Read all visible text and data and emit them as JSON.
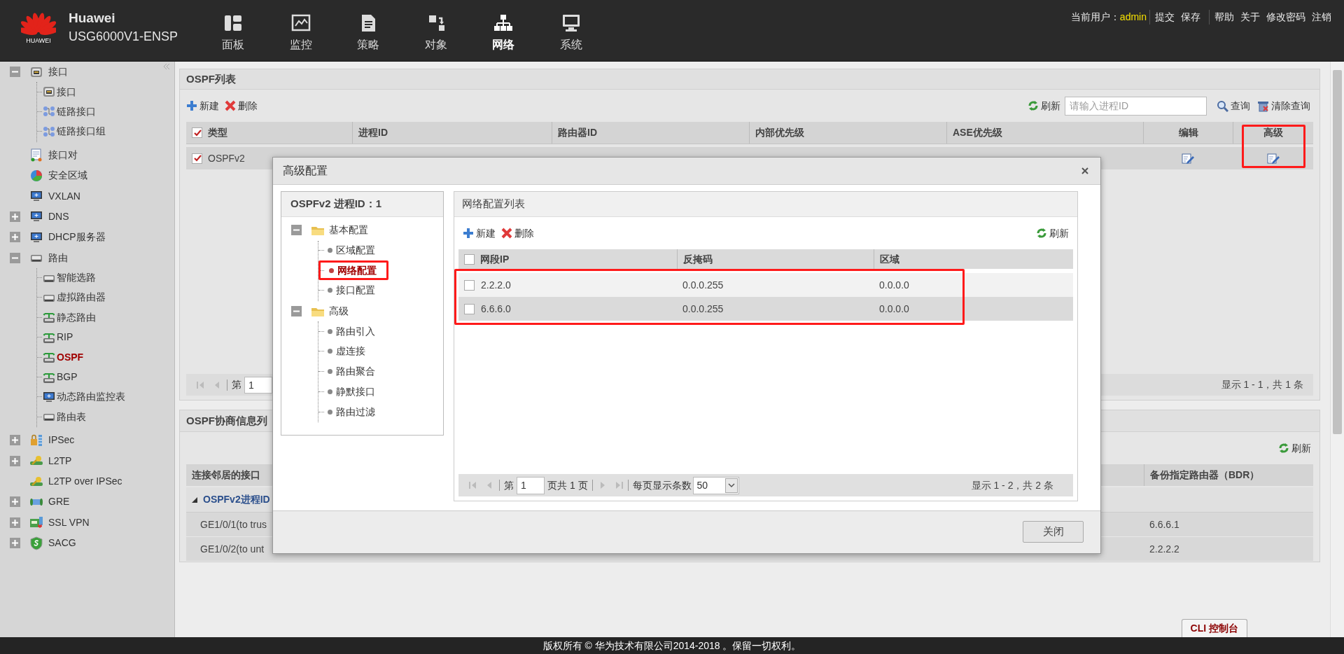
{
  "header": {
    "logo_text": "HUAWEI",
    "brand": "Huawei",
    "model": "USG6000V1-ENSP",
    "nav": [
      {
        "label": "面板",
        "kind": "dashboard",
        "selected": false
      },
      {
        "label": "监控",
        "kind": "monitor",
        "selected": false
      },
      {
        "label": "策略",
        "kind": "policy",
        "selected": false
      },
      {
        "label": "对象",
        "kind": "object",
        "selected": false
      },
      {
        "label": "网络",
        "kind": "network",
        "selected": true
      },
      {
        "label": "系统",
        "kind": "system",
        "selected": false
      }
    ],
    "user_label": "当前用户：",
    "user": "admin",
    "link_groups": [
      [
        "提交",
        "保存"
      ],
      [
        "帮助",
        "关于",
        "修改密码",
        "注销"
      ]
    ]
  },
  "sidebar": {
    "items": [
      {
        "label": "接口",
        "kind": "port",
        "expanded": true,
        "selected": false,
        "children": [
          {
            "label": "接口",
            "kind": "port",
            "selected": false
          },
          {
            "label": "链路接口",
            "kind": "link",
            "selected": false
          },
          {
            "label": "链路接口组",
            "kind": "link",
            "selected": false
          }
        ]
      },
      {
        "label": "接口对",
        "kind": "pair",
        "selected": false
      },
      {
        "label": "安全区域",
        "kind": "zone",
        "selected": false
      },
      {
        "label": "VXLAN",
        "kind": "screen",
        "selected": false
      },
      {
        "label": "DNS",
        "kind": "screen",
        "expanded": false,
        "selected": false
      },
      {
        "label": "DHCP服务器",
        "kind": "screen",
        "expanded": false,
        "selected": false
      },
      {
        "label": "路由",
        "kind": "router",
        "expanded": true,
        "selected": false,
        "children": [
          {
            "label": "智能选路",
            "kind": "router",
            "selected": false
          },
          {
            "label": "虚拟路由器",
            "kind": "router",
            "selected": false
          },
          {
            "label": "静态路由",
            "kind": "antenna",
            "selected": false
          },
          {
            "label": "RIP",
            "kind": "antenna",
            "selected": false
          },
          {
            "label": "OSPF",
            "kind": "antenna",
            "selected": true
          },
          {
            "label": "BGP",
            "kind": "antenna",
            "selected": false
          },
          {
            "label": "动态路由监控表",
            "kind": "screen",
            "selected": false
          },
          {
            "label": "路由表",
            "kind": "router",
            "selected": false
          }
        ]
      },
      {
        "label": "IPSec",
        "kind": "lock",
        "expanded": false,
        "selected": false
      },
      {
        "label": "L2TP",
        "kind": "key",
        "expanded": false,
        "selected": false
      },
      {
        "label": "L2TP over IPSec",
        "kind": "key",
        "selected": false
      },
      {
        "label": "GRE",
        "kind": "tunnel",
        "expanded": false,
        "selected": false
      },
      {
        "label": "SSL VPN",
        "kind": "cert",
        "expanded": false,
        "selected": false
      },
      {
        "label": "SACG",
        "kind": "shield",
        "expanded": false,
        "selected": false
      }
    ]
  },
  "ospf_list": {
    "title": "OSPF列表",
    "toolbar": [
      {
        "label": "新建",
        "kind": "add"
      },
      {
        "label": "删除",
        "kind": "delete"
      }
    ],
    "refresh": "刷新",
    "search": {
      "placeholder": "请输入进程ID"
    },
    "query": "查询",
    "clear_query": "清除查询",
    "table": {
      "all_checked": true,
      "columns": [
        {
          "label": "类型",
          "highlighted": false
        },
        {
          "label": "进程ID",
          "highlighted": false
        },
        {
          "label": "路由器ID",
          "highlighted": false
        },
        {
          "label": "内部优先级",
          "highlighted": false
        },
        {
          "label": "ASE优先级",
          "highlighted": false
        },
        {
          "label": "编辑",
          "highlighted": false
        },
        {
          "label": "高级",
          "highlighted": true
        }
      ],
      "rows": [
        {
          "checked": true,
          "type": "OSPFv2"
        }
      ]
    },
    "pager": {
      "page_label": "第",
      "page": "1",
      "summary": "显示 1 - 1，共 1 条"
    }
  },
  "neighbors": {
    "title": "OSPF协商信息列",
    "refresh": "刷新",
    "columns": [
      "连接邻居的接口",
      "备份指定路由器（BDR）"
    ],
    "group": {
      "label": "OSPFv2进程ID",
      "expanded": true
    },
    "rows": [
      {
        "interface": "GE1/0/1(to trus",
        "bdr": "6.6.6.1"
      },
      {
        "interface": "GE1/0/2(to unt",
        "bdr": "2.2.2.2"
      }
    ]
  },
  "dialog": {
    "title": "高级配置",
    "tree": {
      "title": "OSPFv2 进程ID：1",
      "items": [
        {
          "label": "基本配置",
          "expanded": true,
          "children": [
            {
              "label": "区域配置",
              "selected": false,
              "highlighted": false
            },
            {
              "label": "网络配置",
              "selected": true,
              "highlighted": true
            },
            {
              "label": "接口配置",
              "selected": false,
              "highlighted": false
            }
          ]
        },
        {
          "label": "高级",
          "expanded": true,
          "children": [
            {
              "label": "路由引入",
              "selected": false,
              "highlighted": false
            },
            {
              "label": "虚连接",
              "selected": false,
              "highlighted": false
            },
            {
              "label": "路由聚合",
              "selected": false,
              "highlighted": false
            },
            {
              "label": "静默接口",
              "selected": false,
              "highlighted": false
            },
            {
              "label": "路由过滤",
              "selected": false,
              "highlighted": false
            }
          ]
        }
      ]
    },
    "panel": {
      "title": "网络配置列表",
      "toolbar": [
        {
          "label": "新建",
          "kind": "add"
        },
        {
          "label": "删除",
          "kind": "delete"
        }
      ],
      "refresh": "刷新",
      "table": {
        "all_checked": false,
        "rows_highlighted": true,
        "columns": [
          "网段IP",
          "反掩码",
          "区域"
        ],
        "rows": [
          {
            "checked": false,
            "cells": [
              "2.2.2.0",
              "0.0.0.255",
              "0.0.0.0"
            ]
          },
          {
            "checked": false,
            "cells": [
              "6.6.6.0",
              "0.0.0.255",
              "0.0.0.0"
            ]
          }
        ]
      },
      "pager": {
        "page_label": "第",
        "page": "1",
        "page_total": "页共 1 页",
        "per_page_label": "每页显示条数",
        "per_page": "50",
        "summary": "显示 1 - 2，共 2 条"
      }
    },
    "close_button": "关闭"
  },
  "cli_tab": "CLI 控制台",
  "footer": "版权所有 © 华为技术有限公司2014-2018 。保留一切权利。"
}
